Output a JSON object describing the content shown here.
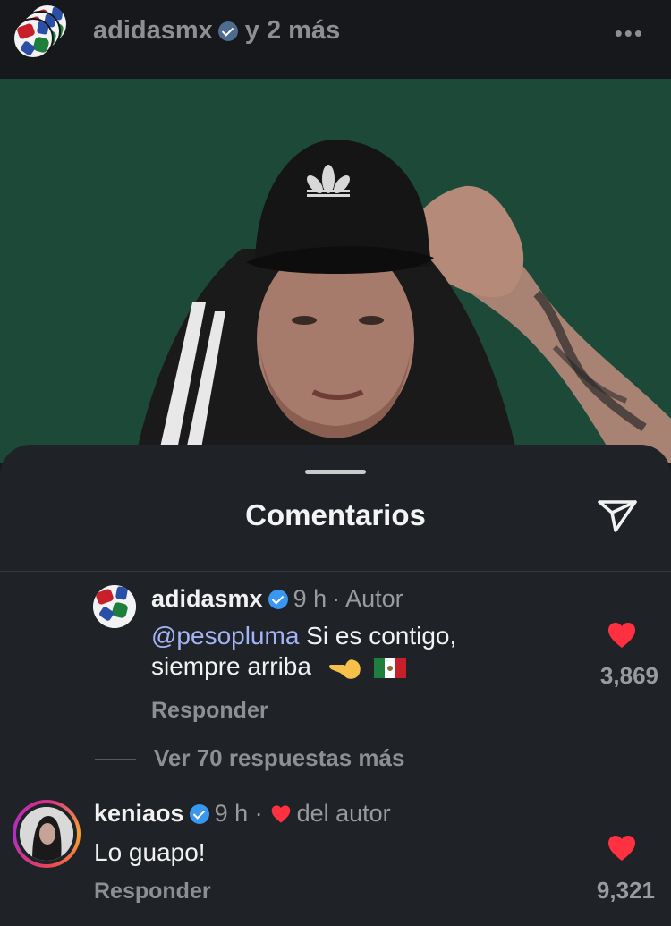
{
  "header": {
    "account": "adidasmx",
    "more_text": "y 2 más",
    "menu_icon": "more-dots-icon",
    "menu_glyph": "•••"
  },
  "post": {
    "image_icon": "post-photo"
  },
  "comments_sheet": {
    "title": "Comentarios",
    "share_icon": "send-icon"
  },
  "comments": [
    {
      "user": "adidasmx",
      "time": "9 h",
      "tag": "· Autor",
      "mention": "@pesopluma",
      "text_line1": " Si es contigo,",
      "text_line2": "siempre arriba",
      "reply_label": "Responder",
      "likes": "3,869",
      "view_replies": "Ver 70 respuestas más"
    },
    {
      "user": "keniaos",
      "time": "9 h ·",
      "tag": "del autor",
      "text": "Lo guapo!",
      "reply_label": "Responder",
      "likes": "9,321"
    }
  ],
  "colors": {
    "background": "#16181b",
    "sheet": "#1f2226",
    "like_red": "#ff3040",
    "mention_blue": "#a4b3f5",
    "verified_blue": "#3897f0",
    "post_green": "#1d4a38"
  }
}
